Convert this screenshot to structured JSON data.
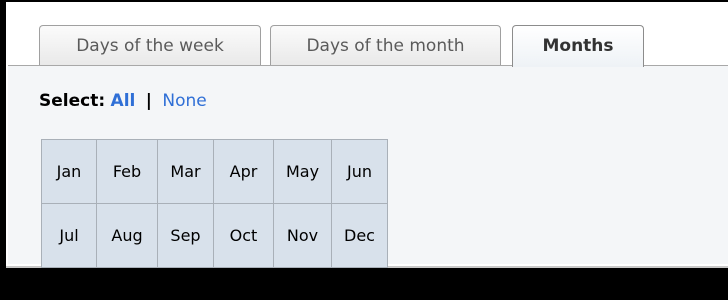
{
  "tabs": [
    {
      "label": "Days of the week",
      "active": false
    },
    {
      "label": "Days of the month",
      "active": false
    },
    {
      "label": "Months",
      "active": true
    }
  ],
  "select": {
    "label": "Select:",
    "all": "All",
    "separator": "|",
    "none": "None"
  },
  "months": {
    "rows": [
      [
        "Jan",
        "Feb",
        "Mar",
        "Apr",
        "May",
        "Jun"
      ],
      [
        "Jul",
        "Aug",
        "Sep",
        "Oct",
        "Nov",
        "Dec"
      ]
    ]
  },
  "colors": {
    "tab_active_text": "#333333",
    "tab_text": "#5a5a5a",
    "link": "#2f6fd6",
    "cell_bg": "#d8e1eb",
    "cell_border": "#a9b0b8"
  }
}
